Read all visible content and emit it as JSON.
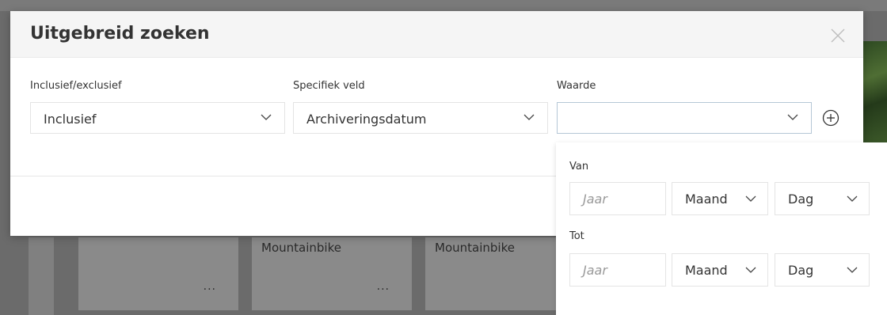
{
  "background": {
    "cards": [
      {
        "title": "",
        "more": "..."
      },
      {
        "title": "Mountainbike",
        "more": "..."
      },
      {
        "title": "Mountainbike",
        "more": ""
      }
    ]
  },
  "modal": {
    "title": "Uitgebreid zoeken",
    "close_icon": "close-icon",
    "fields": {
      "inclusive": {
        "label": "Inclusief/exclusief",
        "value": "Inclusief"
      },
      "field": {
        "label": "Specifiek veld",
        "value": "Archiveringsdatum"
      },
      "value": {
        "label": "Waarde",
        "value": ""
      }
    },
    "add_icon": "plus-circle-icon"
  },
  "date_panel": {
    "from": {
      "label": "Van",
      "year_placeholder": "Jaar",
      "month": "Maand",
      "day": "Dag"
    },
    "to": {
      "label": "Tot",
      "year_placeholder": "Jaar",
      "month": "Maand",
      "day": "Dag"
    }
  },
  "colors": {
    "focus_border": "#b5c7d6",
    "overlay": "#6b6b6b"
  }
}
